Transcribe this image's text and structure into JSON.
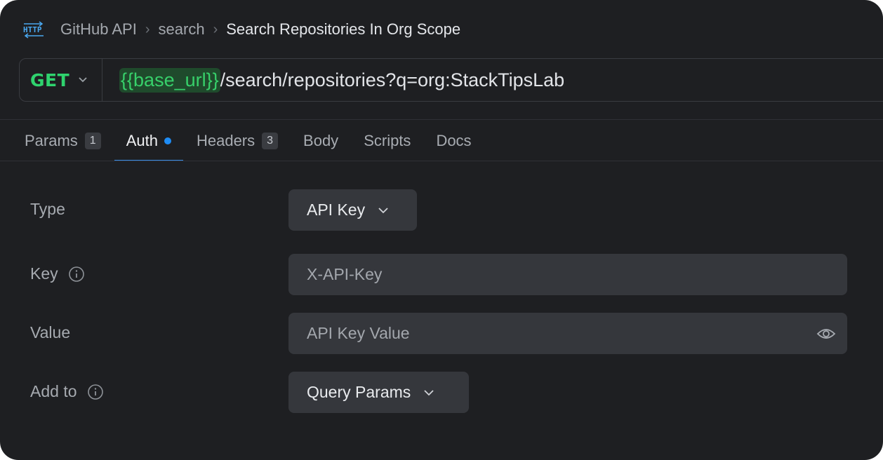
{
  "breadcrumb": {
    "icon": "http-icon",
    "items": [
      "GitHub API",
      "search",
      "Search Repositories In Org Scope"
    ]
  },
  "request": {
    "method": "GET",
    "url_variable": "{{base_url}}",
    "url_path": "/search/repositories?q=org:StackTipsLab"
  },
  "tabs": [
    {
      "label": "Params",
      "count": "1"
    },
    {
      "label": "Auth",
      "active": true,
      "indicator": "dot"
    },
    {
      "label": "Headers",
      "count": "3"
    },
    {
      "label": "Body"
    },
    {
      "label": "Scripts"
    },
    {
      "label": "Docs"
    }
  ],
  "auth": {
    "type_label": "Type",
    "type_value": "API Key",
    "key_label": "Key",
    "key_placeholder": "X-API-Key",
    "value_label": "Value",
    "value_placeholder": "API Key Value",
    "add_to_label": "Add to",
    "add_to_value": "Query Params"
  },
  "colors": {
    "background": "#1e1f22",
    "method_green": "#2fd36e",
    "active_tab_underline": "#3b8ee8",
    "auth_dot": "#1e8cf5",
    "field_bg": "#35373c"
  }
}
